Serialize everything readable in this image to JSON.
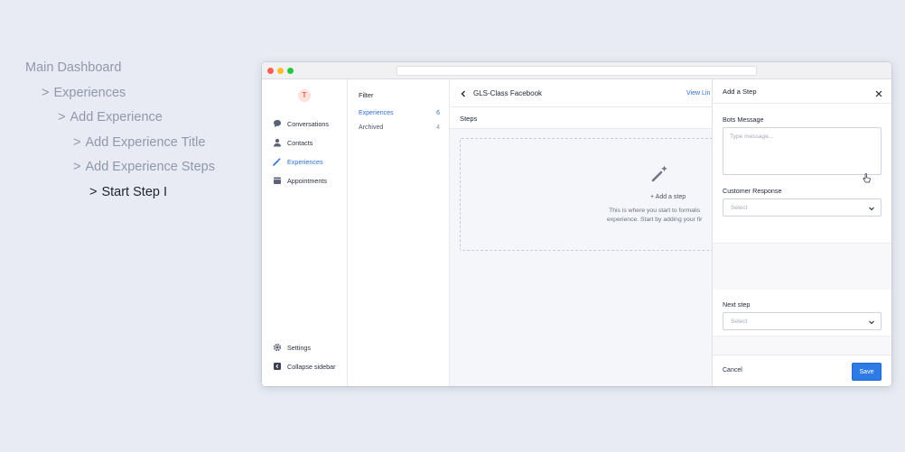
{
  "breadcrumbs": [
    {
      "caret": "",
      "label": "Main Dashboard"
    },
    {
      "caret": ">",
      "label": "Experiences"
    },
    {
      "caret": ">",
      "label": "Add Experience"
    },
    {
      "caret": ">",
      "label": "Add Experience Title"
    },
    {
      "caret": ">",
      "label": "Add Experience Steps"
    },
    {
      "caret": ">",
      "label": "Start Step I"
    }
  ],
  "app": {
    "logo_text": "T",
    "accent_color": "#2f6fd4",
    "save_color": "#2f7be6"
  },
  "sidebar": {
    "items": [
      {
        "label": "Conversations",
        "icon": "chat-bubble-icon"
      },
      {
        "label": "Contacts",
        "icon": "person-icon"
      },
      {
        "label": "Experiences",
        "icon": "magic-wand-icon",
        "active": true
      },
      {
        "label": "Appointments",
        "icon": "calendar-icon"
      }
    ],
    "settings_label": "Settings",
    "collapse_label": "Collapse sidebar"
  },
  "filter": {
    "title": "Filter",
    "rows": [
      {
        "label": "Experiences",
        "count": "6",
        "active": true
      },
      {
        "label": "Archived",
        "count": "4"
      }
    ]
  },
  "main": {
    "title": "GLS-Class Facebook",
    "view_link": "View Lin",
    "steps_label": "Steps",
    "add_step": "+ Add a step",
    "desc_line1": "This is where you start to formalis",
    "desc_line2": "experience. Start by adding your fir"
  },
  "panel": {
    "title": "Add a Step",
    "bots_message_label": "Bots Message",
    "message_placeholder": "Type message...",
    "customer_response_label": "Customer Response",
    "customer_response_value": "Select",
    "next_step_label": "Next step",
    "next_step_value": "Select",
    "cancel_label": "Cancel",
    "save_label": "Save"
  }
}
